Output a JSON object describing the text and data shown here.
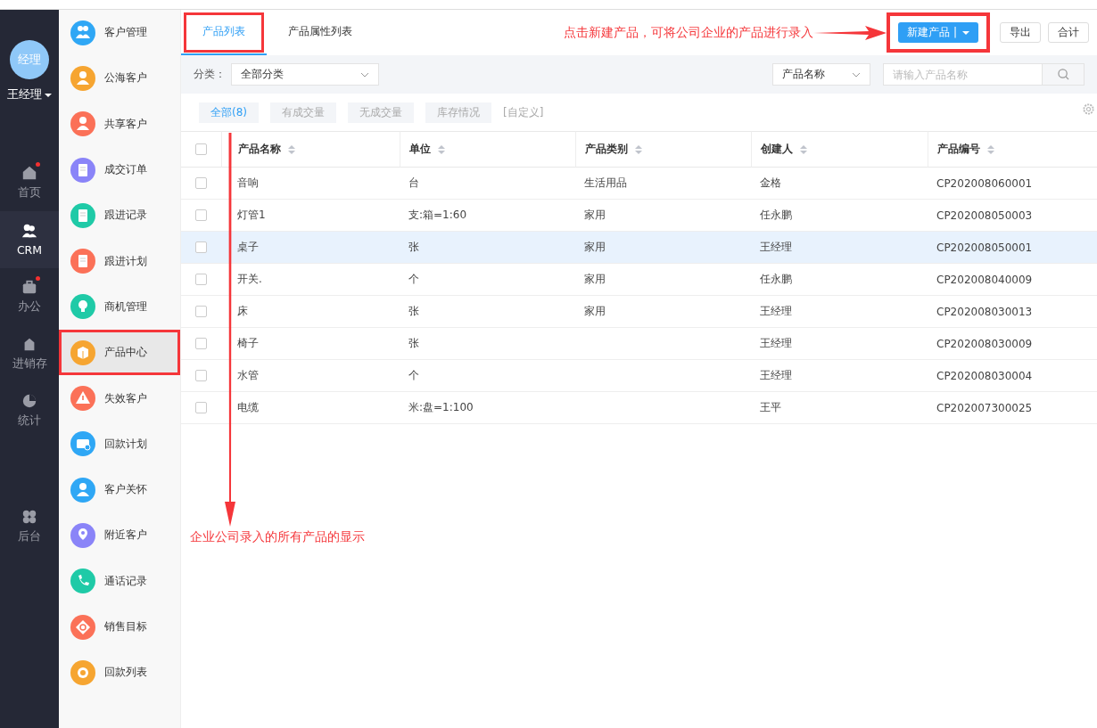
{
  "user": {
    "avatar": "经理",
    "name": "王经理"
  },
  "rail": [
    {
      "label": "首页",
      "selected": false,
      "badge": true
    },
    {
      "label": "CRM",
      "selected": true,
      "badge": false
    },
    {
      "label": "办公",
      "selected": false,
      "badge": true
    },
    {
      "label": "进销存",
      "selected": false,
      "badge": false
    },
    {
      "label": "统计",
      "selected": false,
      "badge": false
    },
    {
      "label": "后台",
      "selected": false,
      "badge": false
    }
  ],
  "menu": [
    {
      "label": "客户管理",
      "color": "#2fa7f5",
      "selected": false
    },
    {
      "label": "公海客户",
      "color": "#f6a531",
      "selected": false
    },
    {
      "label": "共享客户",
      "color": "#fb7158",
      "selected": false
    },
    {
      "label": "成交订单",
      "color": "#8a84f8",
      "selected": false
    },
    {
      "label": "跟进记录",
      "color": "#1fcaa7",
      "selected": false
    },
    {
      "label": "跟进计划",
      "color": "#fb7158",
      "selected": false
    },
    {
      "label": "商机管理",
      "color": "#1fcaa7",
      "selected": false
    },
    {
      "label": "产品中心",
      "color": "#f6a531",
      "selected": true
    },
    {
      "label": "失效客户",
      "color": "#fb7158",
      "selected": false
    },
    {
      "label": "回款计划",
      "color": "#2fa7f5",
      "selected": false
    },
    {
      "label": "客户关怀",
      "color": "#2fa7f5",
      "selected": false
    },
    {
      "label": "附近客户",
      "color": "#8a84f8",
      "selected": false
    },
    {
      "label": "通话记录",
      "color": "#1fcaa7",
      "selected": false
    },
    {
      "label": "销售目标",
      "color": "#fb7158",
      "selected": false
    },
    {
      "label": "回款列表",
      "color": "#f6a531",
      "selected": false
    }
  ],
  "tabs": [
    {
      "label": "产品列表",
      "selected": true
    },
    {
      "label": "产品属性列表",
      "selected": false
    }
  ],
  "top_note": "点击新建产品，可将公司企业的产品进行录入",
  "new_button": {
    "label": "新建产品 |"
  },
  "buttons": [
    "导出",
    "合计"
  ],
  "filter": {
    "label": "分类：",
    "category": "全部分类",
    "search_field": "产品名称",
    "placeholder": "请输入产品名称"
  },
  "quick_filters": [
    {
      "label": "全部(8)",
      "selected": true
    },
    {
      "label": "有成交量",
      "selected": false
    },
    {
      "label": "无成交量",
      "selected": false
    },
    {
      "label": "库存情况",
      "selected": false
    }
  ],
  "customize": "[自定义]",
  "table": {
    "all_checked": false,
    "columns": [
      "产品名称",
      "单位",
      "产品类别",
      "创建人",
      "产品编号"
    ],
    "rows": [
      {
        "cells": [
          "音响",
          "台",
          "生活用品",
          "金格",
          "CP202008060001"
        ],
        "selected": false,
        "checked": false
      },
      {
        "cells": [
          "灯管1",
          "支:箱=1:60",
          "家用",
          "任永鹏",
          "CP202008050003"
        ],
        "selected": false,
        "checked": false
      },
      {
        "cells": [
          "桌子",
          "张",
          "家用",
          "王经理",
          "CP202008050001"
        ],
        "selected": true,
        "checked": false
      },
      {
        "cells": [
          "开关.",
          "个",
          "家用",
          "任永鹏",
          "CP202008040009"
        ],
        "selected": false,
        "checked": false
      },
      {
        "cells": [
          "床",
          "张",
          "家用",
          "王经理",
          "CP202008030013"
        ],
        "selected": false,
        "checked": false
      },
      {
        "cells": [
          "椅子",
          "张",
          "",
          "王经理",
          "CP202008030009"
        ],
        "selected": false,
        "checked": false
      },
      {
        "cells": [
          "水管",
          "个",
          "",
          "王经理",
          "CP202008030004"
        ],
        "selected": false,
        "checked": false
      },
      {
        "cells": [
          "电缆",
          "米:盘=1:100",
          "",
          "王平",
          "CP202007300025"
        ],
        "selected": false,
        "checked": false
      }
    ]
  },
  "bottom_note": "企业公司录入的所有产品的显示"
}
